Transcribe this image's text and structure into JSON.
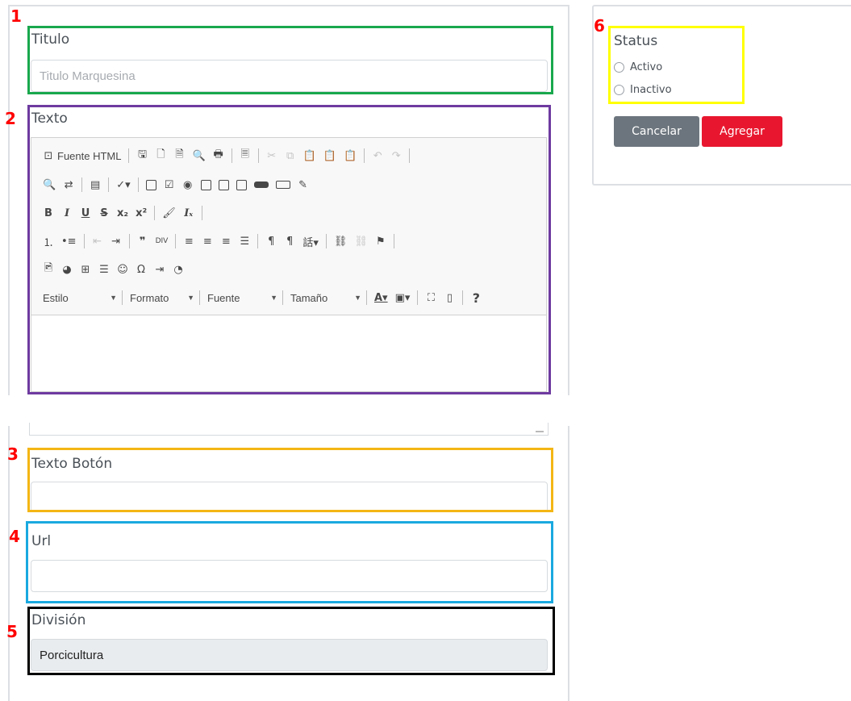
{
  "annotations": [
    "1",
    "2",
    "3",
    "4",
    "5",
    "6"
  ],
  "colors": {
    "titulo_box": "#19a84d",
    "texto_box": "#6e3aa0",
    "texto_boton_box": "#f4b615",
    "url_box": "#1aa9e0",
    "division_box": "#000000",
    "status_box": "#ffff00",
    "cancel": "#6c757d",
    "add": "#e8172f"
  },
  "form": {
    "titulo": {
      "label": "Titulo",
      "placeholder": "Titulo Marquesina",
      "value": ""
    },
    "texto": {
      "label": "Texto"
    },
    "texto_boton": {
      "label": "Texto Botón",
      "value": ""
    },
    "url": {
      "label": "Url",
      "value": ""
    },
    "division": {
      "label": "División",
      "value": "Porcicultura"
    }
  },
  "editor": {
    "source_label": "Fuente HTML",
    "combos": {
      "style": "Estilo",
      "format": "Formato",
      "font": "Fuente",
      "size": "Tamaño"
    },
    "help": "?",
    "icons": [
      "save-icon",
      "new-page-icon",
      "pdf-icon",
      "preview-icon",
      "print-icon",
      "templates-icon",
      "cut-icon",
      "copy-icon",
      "paste-icon",
      "paste-text-icon",
      "paste-word-icon",
      "undo-icon",
      "redo-icon",
      "find-icon",
      "replace-icon",
      "select-all-icon",
      "spellcheck-icon",
      "form-icon",
      "checkbox-icon",
      "radio-icon",
      "textfield-icon",
      "textarea-icon",
      "select-icon",
      "button-icon",
      "image-button-icon",
      "hidden-field-icon",
      "bold-icon",
      "italic-icon",
      "underline-icon",
      "strike-icon",
      "subscript-icon",
      "superscript-icon",
      "copy-format-icon",
      "remove-format-icon",
      "numbered-list-icon",
      "bulleted-list-icon",
      "outdent-icon",
      "indent-icon",
      "blockquote-icon",
      "div-icon",
      "align-left-icon",
      "align-center-icon",
      "align-right-icon",
      "justify-icon",
      "ltr-icon",
      "rtl-icon",
      "language-icon",
      "link-icon",
      "unlink-icon",
      "anchor-icon",
      "image-icon",
      "flash-icon",
      "table-icon",
      "hr-icon",
      "smiley-icon",
      "special-char-icon",
      "page-break-icon",
      "iframe-icon",
      "text-color-icon",
      "bg-color-icon",
      "maximize-icon",
      "show-blocks-icon",
      "help-icon"
    ]
  },
  "status": {
    "label": "Status",
    "options": [
      "Activo",
      "Inactivo"
    ]
  },
  "actions": {
    "cancel": "Cancelar",
    "add": "Agregar"
  }
}
